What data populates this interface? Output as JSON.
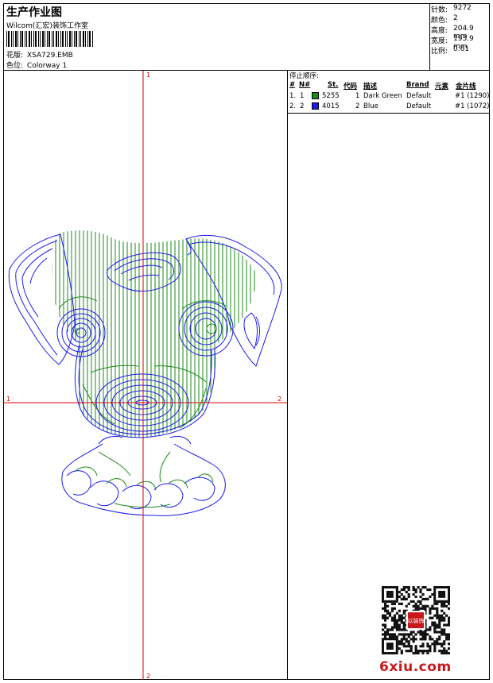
{
  "header": {
    "title": "生产作业图",
    "company": "Wilcom(汇宏)装饰工作室",
    "design_label": "花版:",
    "design_value": "XSA729.EMB",
    "colorway_label": "色位:",
    "colorway_value": "Colorway 1"
  },
  "stats": [
    {
      "label": "针数:",
      "value": "9272"
    },
    {
      "label": "颜色:",
      "value": "2"
    },
    {
      "label": "高度:",
      "value": "204.9 mm"
    },
    {
      "label": "宽度:",
      "value": "193.9 mm"
    },
    {
      "label": "比例:",
      "value": "0.61"
    }
  ],
  "stop_sequence": {
    "caption": "停止顺序:",
    "headers": {
      "num": "#",
      "n": "N#",
      "st": "St.",
      "code": "代码",
      "desc": "描述",
      "brand": "Brand",
      "elem": "元素",
      "thread": "金片线"
    },
    "rows": [
      {
        "num": "1.",
        "n": "1",
        "swatch": "#1a8a1a",
        "st": "5255",
        "code": "1",
        "desc": "Dark Green",
        "brand": "Default",
        "thread": "#1 (1290)"
      },
      {
        "num": "2.",
        "n": "2",
        "swatch": "#1a1aee",
        "st": "4015",
        "code": "2",
        "desc": "Blue",
        "brand": "Default",
        "thread": "#1 (1072)"
      }
    ]
  },
  "axes": {
    "top": "1",
    "bottom": "2",
    "left": "1",
    "right": "2"
  },
  "colors": {
    "green": "#1a8a1a",
    "blue": "#1a1aee",
    "axis": "#dd0000",
    "site": "#c8181b"
  },
  "watermark": "6xiu.com",
  "stamp_text": "以装饰"
}
